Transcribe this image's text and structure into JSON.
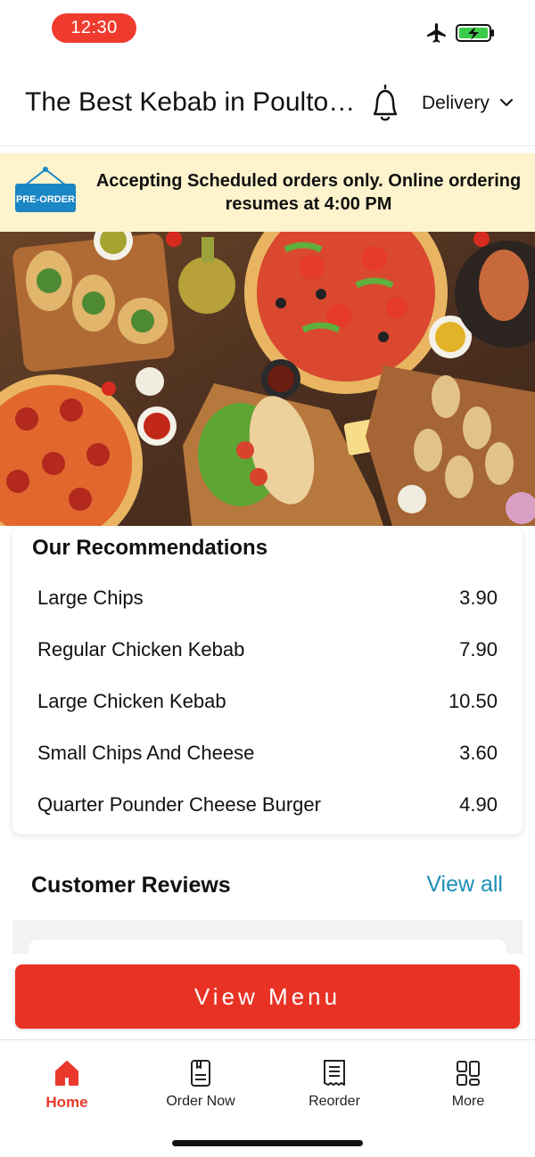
{
  "status_bar": {
    "time": "12:30"
  },
  "header": {
    "title": "The Best Kebab in Poulton...",
    "mode": "Delivery"
  },
  "banner": {
    "sign_text": "PRE-ORDER",
    "message": "Accepting Scheduled orders only. Online ordering resumes at 4:00 PM"
  },
  "recommendations": {
    "title": "Our Recommendations",
    "items": [
      {
        "name": "Large Chips",
        "price": "3.90"
      },
      {
        "name": "Regular Chicken Kebab",
        "price": "7.90"
      },
      {
        "name": "Large Chicken Kebab",
        "price": "10.50"
      },
      {
        "name": "Small Chips And Cheese",
        "price": "3.60"
      },
      {
        "name": "Quarter Pounder Cheese Burger",
        "price": "4.90"
      }
    ]
  },
  "reviews": {
    "title": "Customer Reviews",
    "view_all": "View all"
  },
  "cta": {
    "label": "View Menu"
  },
  "tabs": [
    {
      "label": "Home",
      "icon": "home-icon",
      "active": true
    },
    {
      "label": "Order Now",
      "icon": "order-icon",
      "active": false
    },
    {
      "label": "Reorder",
      "icon": "receipt-icon",
      "active": false
    },
    {
      "label": "More",
      "icon": "grid-icon",
      "active": false
    }
  ],
  "colors": {
    "accent": "#e83224",
    "link": "#1c8fb8",
    "banner_bg": "#fdf3cc",
    "sign": "#1a86c4"
  }
}
